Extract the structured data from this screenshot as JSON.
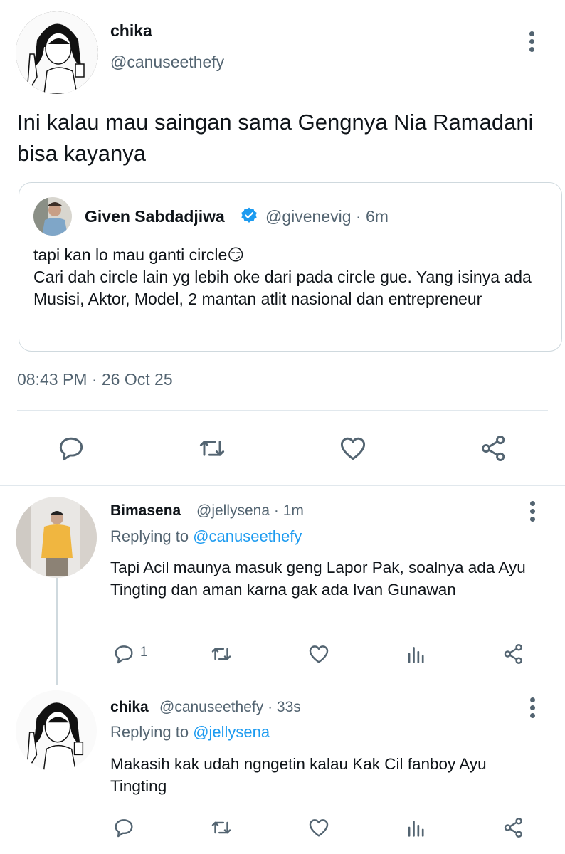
{
  "main_tweet": {
    "author_name": "chika",
    "author_handle": "@canuseethefy",
    "text": "Ini kalau mau saingan sama Gengnya Nia Ramadani bisa kayanya",
    "timestamp": "08:43 PM · 26 Oct 25",
    "quote": {
      "author_name": "Given Sabdadjiwa",
      "author_handle": "@givenevig",
      "time_ago": "6m",
      "meta": "@givenevig · 6m",
      "text_line1": "tapi kan lo mau ganti circle😏",
      "text_line2": "Cari dah circle lain yg lebih oke dari pada circle gue. Yang isinya ada Musisi, Aktor, Model, 2 mantan atlit nasional dan entrepreneur"
    },
    "actions": [
      "reply-icon",
      "retweet-icon",
      "like-icon",
      "share-icon"
    ]
  },
  "replies": [
    {
      "author_name": "Bimasena",
      "meta": "@jellysena · 1m",
      "replying_prefix": "Replying to ",
      "replying_to": "@canuseethefy",
      "text": "Tapi Acil maunya masuk geng Lapor Pak, soalnya ada Ayu Tingting dan aman karna gak ada Ivan Gunawan",
      "reply_count": "1"
    },
    {
      "author_name": "chika",
      "meta": "@canuseethefy · 33s",
      "replying_prefix": "Replying to ",
      "replying_to": "@jellysena",
      "text": "Makasih kak udah ngngetin kalau Kak Cil fanboy Ayu Tingting",
      "reply_count": ""
    }
  ],
  "colors": {
    "accent": "#1d9bf0",
    "secondary_text": "#536471",
    "border": "#cfd9de"
  }
}
